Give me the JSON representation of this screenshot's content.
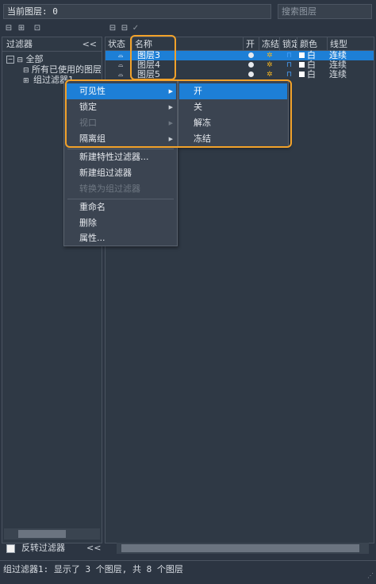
{
  "top": {
    "current_layer_label": "当前图层: 0",
    "search_placeholder": "搜索图层"
  },
  "filter_panel": {
    "title": "过滤器",
    "collapse_glyph": "<<",
    "tree": {
      "all": "全部",
      "used": "所有已使用的图层",
      "group": "组过滤器1"
    },
    "invert_label": "反转过滤器",
    "invert_checked": false
  },
  "layer_table": {
    "headers": {
      "status": "状态",
      "name": "名称",
      "on": "开",
      "freeze": "冻结",
      "lock": "锁定",
      "color": "颜色",
      "linetype": "线型"
    },
    "rows": [
      {
        "name": "图层3",
        "color": "白",
        "linetype": "连续",
        "selected": true
      },
      {
        "name": "图层4",
        "color": "白",
        "linetype": "连续",
        "selected": false
      },
      {
        "name": "图层5",
        "color": "白",
        "linetype": "连续",
        "selected": false
      }
    ]
  },
  "context_menu": {
    "visibility": "可见性",
    "lock": "锁定",
    "viewport": "视口",
    "isolate_group": "隔离组",
    "new_prop_filter": "新建特性过滤器...",
    "new_group_filter": "新建组过滤器",
    "convert_group": "转换为组过滤器",
    "rename": "重命名",
    "delete": "删除",
    "properties": "属性..."
  },
  "submenu": {
    "on": "开",
    "off": "关",
    "thaw": "解冻",
    "freeze": "冻结"
  },
  "status": {
    "text": "组过滤器1: 显示了 3 个图层, 共 8 个图层"
  },
  "colors": {
    "accent": "#1d7fd6",
    "callout": "#f2a22a",
    "background": "#2c3542"
  }
}
